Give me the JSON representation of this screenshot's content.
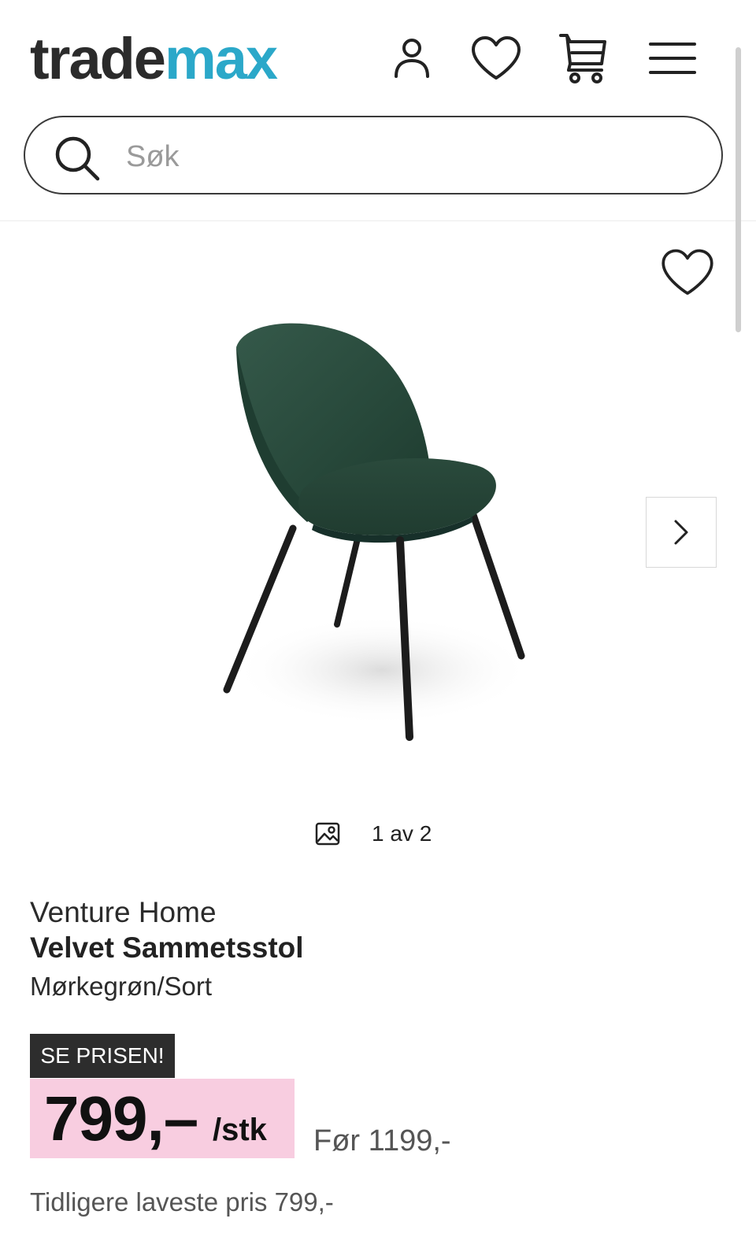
{
  "header": {
    "logo_part1": "trade",
    "logo_part2": "max",
    "icons": [
      "user-icon",
      "heart-icon",
      "cart-icon",
      "menu-icon"
    ]
  },
  "search": {
    "placeholder": "Søk"
  },
  "gallery": {
    "counter": "1 av 2",
    "image_alt": "chair"
  },
  "product": {
    "brand": "Venture Home",
    "name": "Velvet Sammetsstol",
    "variant": "Mørkegrøn/Sort",
    "badge": "SE PRISEN!",
    "price": "799,–",
    "unit": "/stk",
    "before_price": "Før 1199,-",
    "lowest_price": "Tidligere laveste pris 799,-"
  },
  "colors": {
    "logo_dark": "#2b2b2b",
    "logo_accent": "#2ba8c9",
    "badge_bg": "#2d2d2d",
    "price_bg": "#f8cde0",
    "chair_green": "#27483a"
  }
}
